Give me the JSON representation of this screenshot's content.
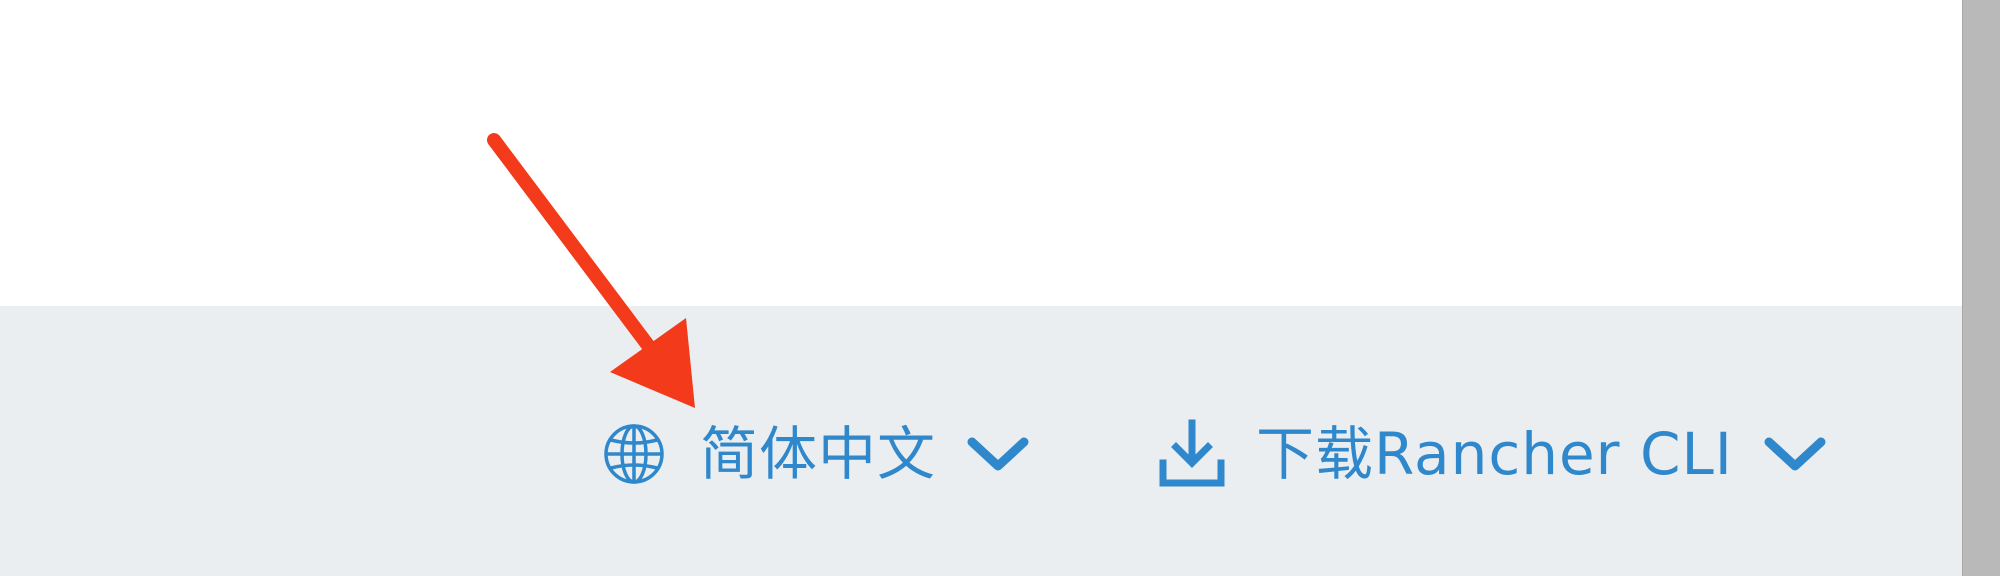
{
  "footer": {
    "language": {
      "label": "简体中文",
      "icon": "globe-icon",
      "dropdown_icon": "chevron-down-icon"
    },
    "cli_download": {
      "label": "下载Rancher CLI",
      "icon": "download-icon",
      "dropdown_icon": "chevron-down-icon"
    }
  },
  "annotation": {
    "icon": "red-arrow",
    "color": "#f33a1a"
  },
  "colors": {
    "link": "#2f87cc",
    "footer_bg": "#ebeef0",
    "content_bg": "#ffffff",
    "scrollbar": "#b9b9b9"
  }
}
